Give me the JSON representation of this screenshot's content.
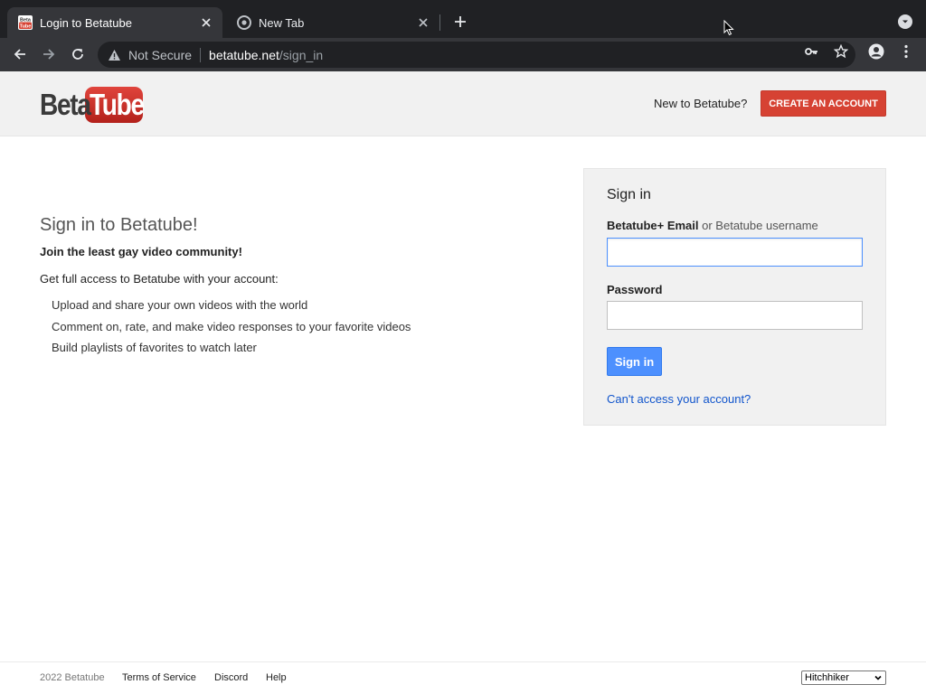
{
  "browser": {
    "tabs": [
      {
        "title": "Login to Betatube",
        "favicon": "betatube-favicon",
        "active": true
      },
      {
        "title": "New Tab",
        "favicon": "chrome-icon",
        "active": false
      }
    ],
    "omnibox": {
      "security_label": "Not Secure",
      "url_host": "betatube.net",
      "url_path": "/sign_in"
    },
    "favicon_text_1": "Beta",
    "favicon_text_2": "Tube"
  },
  "header": {
    "logo_beta": "Beta",
    "logo_tube": "Tube",
    "new_to_text": "New to Betatube?",
    "create_account_label": "CREATE AN ACCOUNT"
  },
  "intro": {
    "heading": "Sign in to Betatube!",
    "tagline": "Join the least gay video community!",
    "lead": "Get full access to Betatube with your account:",
    "features": [
      "Upload and share your own videos with the world",
      "Comment on, rate, and make video responses to your favorite videos",
      "Build playlists of favorites to watch later"
    ]
  },
  "signin": {
    "title": "Sign in",
    "email_label_bold": "Betatube+ Email",
    "email_label_rest": "or Betatube username",
    "email_value": "",
    "password_label": "Password",
    "password_value": "",
    "submit_label": "Sign in",
    "cant_access_label": "Can't access your account?"
  },
  "footer": {
    "copyright": "2022 Betatube",
    "links": [
      "Terms of Service",
      "Discord",
      "Help"
    ],
    "language_selected": "Hitchhiker"
  },
  "colors": {
    "brand_red": "#d64233",
    "link_blue": "#1155cc",
    "button_blue": "#4d90fe"
  }
}
